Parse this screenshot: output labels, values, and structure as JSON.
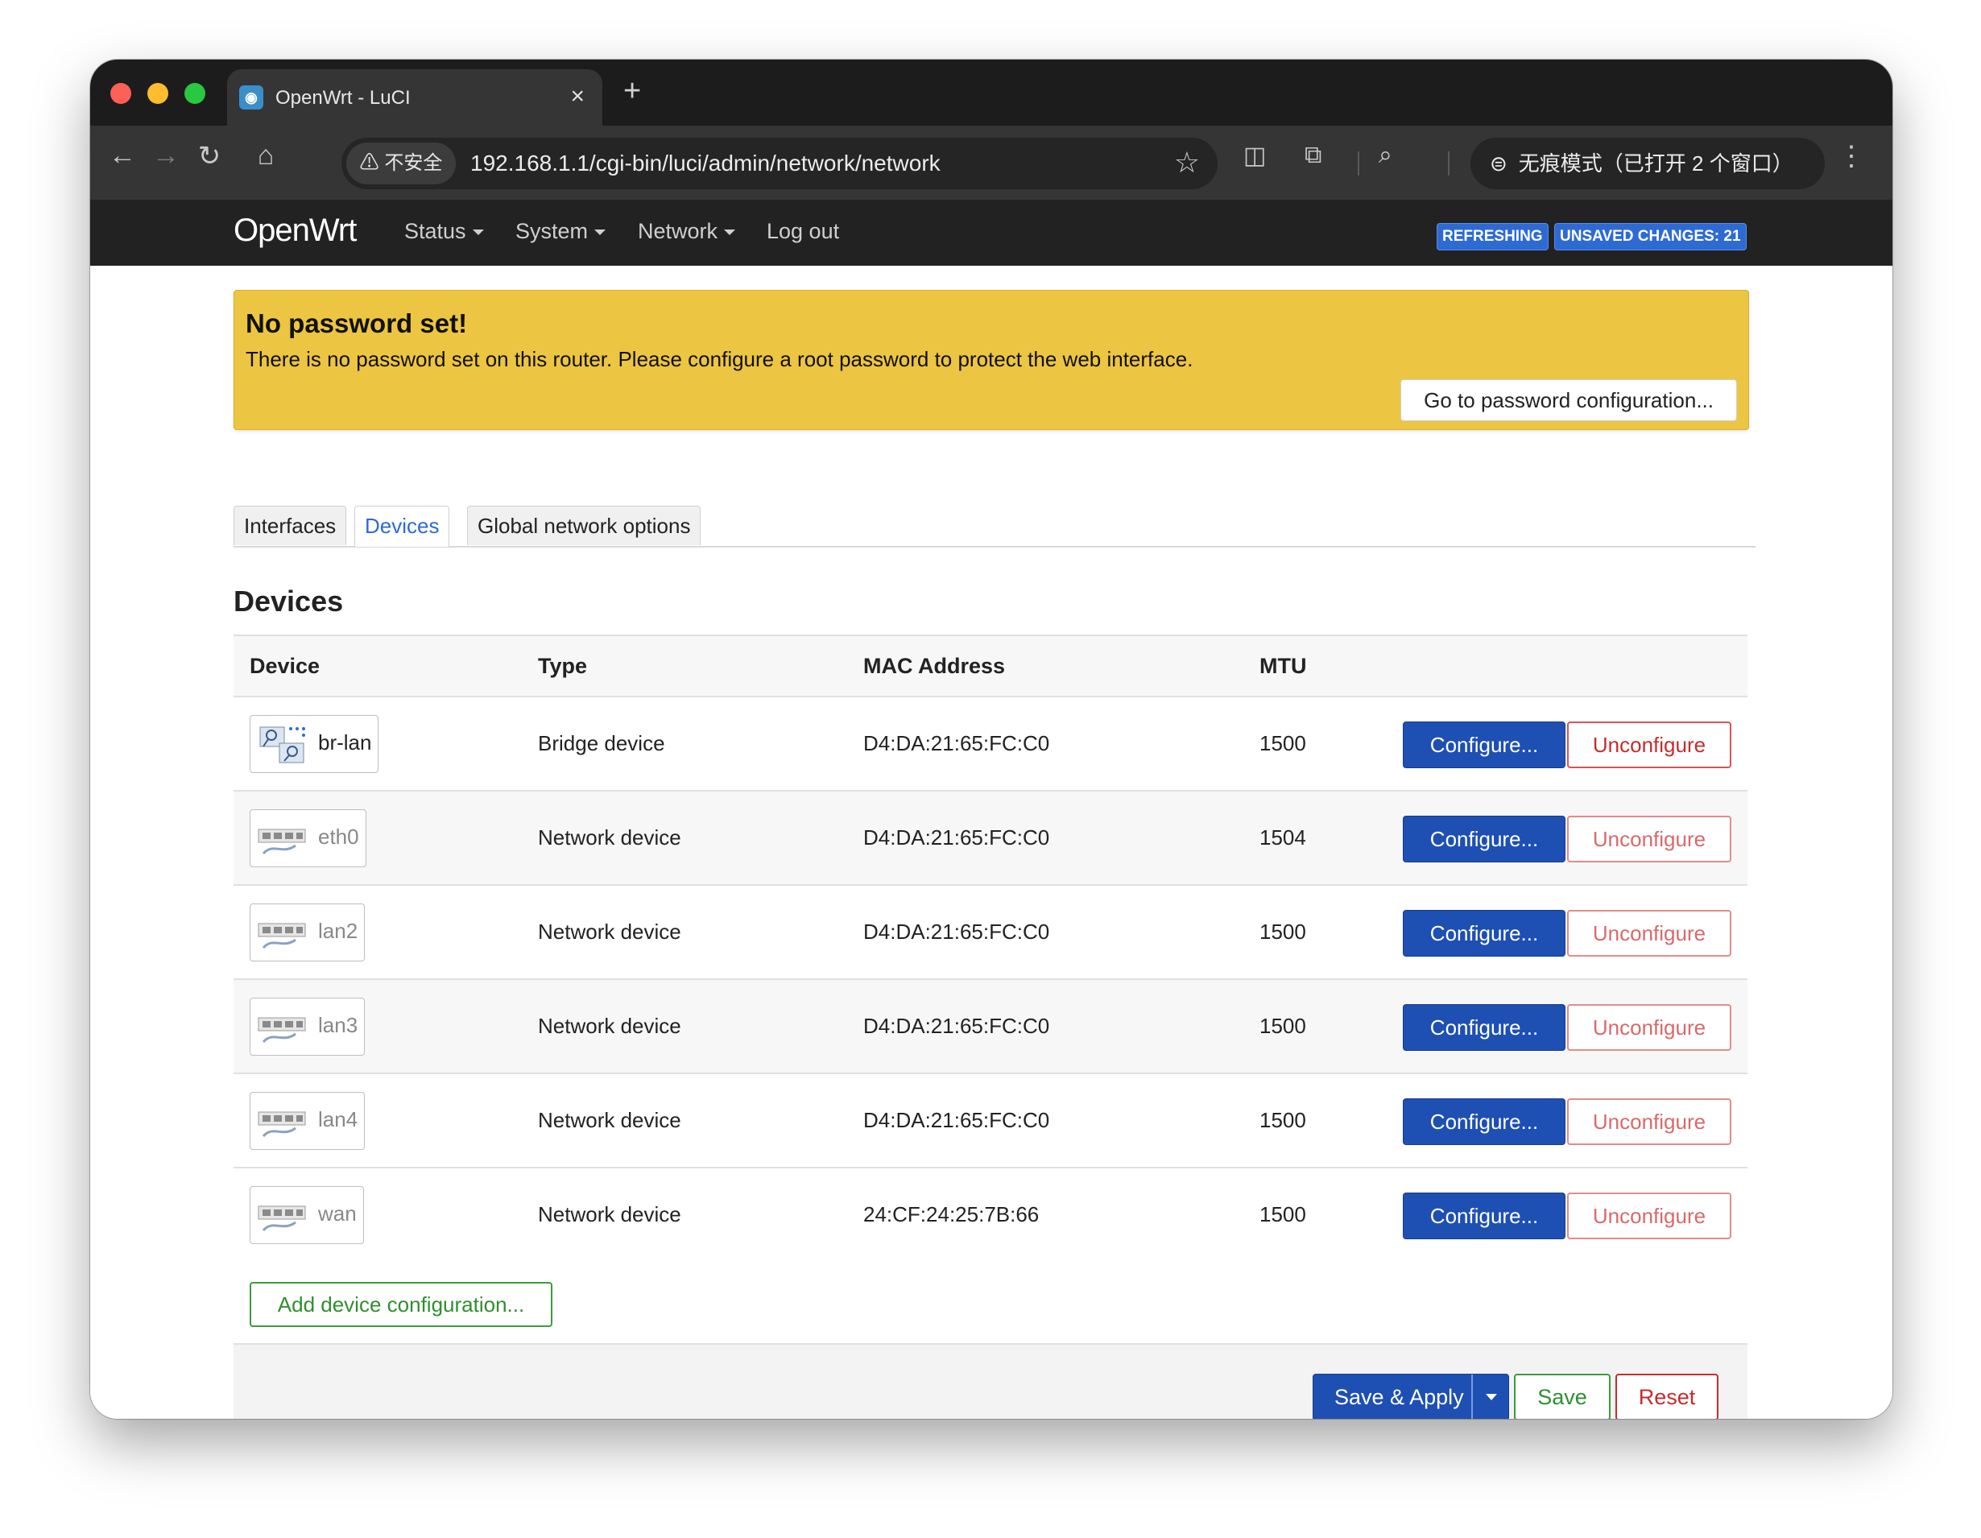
{
  "browser": {
    "tab_title": "OpenWrt - LuCI",
    "tab_close": "×",
    "new_tab": "+",
    "security_label": "⚠ 不安全",
    "url": "192.168.1.1/cgi-bin/luci/admin/network/network",
    "incognito_label": "无痕模式（已打开 2 个窗口）"
  },
  "header": {
    "brand": "OpenWrt",
    "menu": [
      "Status",
      "System",
      "Network",
      "Log out"
    ],
    "badge_refreshing": "REFRESHING",
    "badge_unsaved": "UNSAVED CHANGES: 21"
  },
  "alert": {
    "title": "No password set!",
    "text": "There is no password set on this router. Please configure a root password to protect the web interface.",
    "button": "Go to password configuration..."
  },
  "tabs": [
    {
      "label": "Interfaces",
      "active": false
    },
    {
      "label": "Devices",
      "active": true
    },
    {
      "label": "Global network options",
      "active": false
    }
  ],
  "section_title": "Devices",
  "table": {
    "headers": [
      "Device",
      "Type",
      "MAC Address",
      "MTU"
    ],
    "rows": [
      {
        "device": "br-lan",
        "type": "Bridge device",
        "mac": "D4:DA:21:65:FC:C0",
        "mtu": "1500",
        "configure": "Configure...",
        "unconfigure": "Unconfigure"
      },
      {
        "device": "eth0",
        "type": "Network device",
        "mac": "D4:DA:21:65:FC:C0",
        "mtu": "1504",
        "configure": "Configure...",
        "unconfigure": "Unconfigure"
      },
      {
        "device": "lan2",
        "type": "Network device",
        "mac": "D4:DA:21:65:FC:C0",
        "mtu": "1500",
        "configure": "Configure...",
        "unconfigure": "Unconfigure"
      },
      {
        "device": "lan3",
        "type": "Network device",
        "mac": "D4:DA:21:65:FC:C0",
        "mtu": "1500",
        "configure": "Configure...",
        "unconfigure": "Unconfigure"
      },
      {
        "device": "lan4",
        "type": "Network device",
        "mac": "D4:DA:21:65:FC:C0",
        "mtu": "1500",
        "configure": "Configure...",
        "unconfigure": "Unconfigure"
      },
      {
        "device": "wan",
        "type": "Network device",
        "mac": "24:CF:24:25:7B:66",
        "mtu": "1500",
        "configure": "Configure...",
        "unconfigure": "Unconfigure"
      }
    ]
  },
  "add_device_button": "Add device configuration...",
  "footer": {
    "save_apply": "Save & Apply",
    "save": "Save",
    "reset": "Reset"
  },
  "colors": {
    "primary": "#1e4fb3",
    "danger": "#c62c2c",
    "success": "#2f8f2f",
    "alert_bg": "#ecc542"
  }
}
